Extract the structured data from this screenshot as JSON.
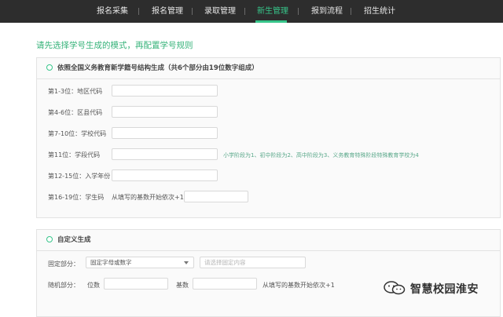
{
  "nav": {
    "items": [
      {
        "label": "报名采集"
      },
      {
        "label": "报名管理"
      },
      {
        "label": "录取管理"
      },
      {
        "label": "新生管理"
      },
      {
        "label": "报到流程"
      },
      {
        "label": "招生统计"
      }
    ],
    "active_index": 3,
    "active_color": "#37c58a"
  },
  "instruction": "请先选择学号生成的模式，再配置学号规则",
  "national": {
    "title": "依照全国义务教育新学籍号结构生成（共6个部分由19位数字组成）",
    "rows": [
      {
        "label": "第1-3位：地区代码",
        "value": ""
      },
      {
        "label": "第4-6位：区县代码",
        "value": ""
      },
      {
        "label": "第7-10位：学校代码",
        "value": ""
      },
      {
        "label": "第11位：学段代码",
        "value": "",
        "hint": "小学阶段为1、初中阶段为2、高中阶段为3、义务教育特殊阶段特殊教育学校为4"
      },
      {
        "label": "第12-15位：入学年份",
        "value": ""
      },
      {
        "label": "第16-19位：学生码",
        "value": "",
        "prefix": "从填写的基数开始依次+1"
      }
    ]
  },
  "custom": {
    "title": "自定义生成",
    "fixed_label": "固定部分：",
    "fixed_select": "固定字母或数字",
    "fixed_input_placeholder": "请选择固定内容",
    "random_label": "随机部分：",
    "digits_label": "位数",
    "base_label": "基数",
    "random_suffix": "从填写的基数开始依次+1"
  },
  "watermark": {
    "text": "智慧校园淮安",
    "icon": "wechat-icon"
  }
}
